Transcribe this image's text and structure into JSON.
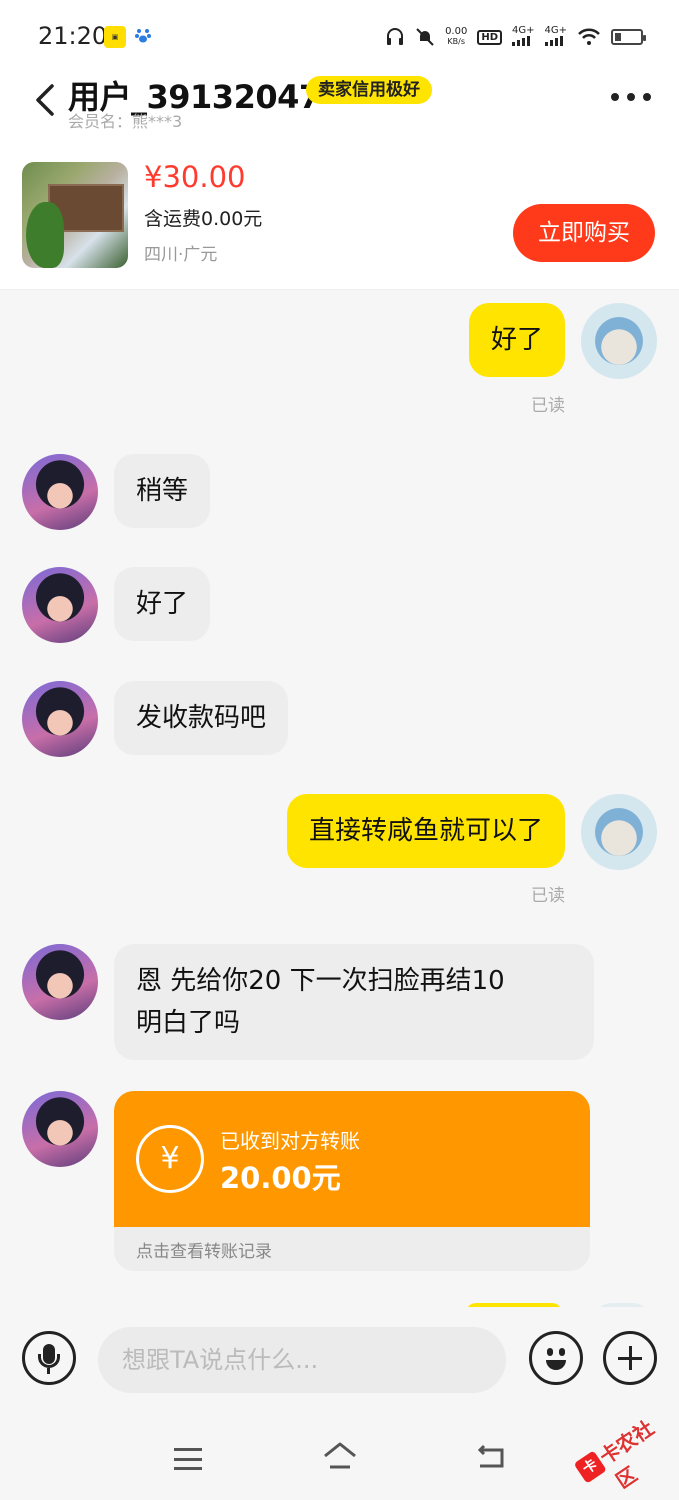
{
  "status_bar": {
    "time": "21:20",
    "net_speed": "0.00",
    "net_unit": "KB/s",
    "hd": "HD",
    "signal1": "4G+",
    "signal2": "4G+"
  },
  "header": {
    "title": "用户_39132047",
    "badge": "卖家信用极好",
    "subtitle": "会员名：熊***3"
  },
  "product": {
    "price": "¥30.00",
    "shipping": "含运费0.00元",
    "location": "四川·广元",
    "buy_label": "立即购买"
  },
  "messages": [
    {
      "side": "right",
      "text": "好了",
      "read": "已读"
    },
    {
      "side": "left",
      "text": "稍等"
    },
    {
      "side": "left",
      "text": "好了"
    },
    {
      "side": "left",
      "text": "发收款码吧"
    },
    {
      "side": "right",
      "text": "直接转咸鱼就可以了",
      "read": "已读"
    },
    {
      "side": "left",
      "text_line1": "恩  先给你20 下一次扫脸再结10",
      "text_line2": "明白了吗"
    }
  ],
  "transfer": {
    "label": "已收到对方转账",
    "amount": "20.00元",
    "link": "点击查看转账记录",
    "icon": "yuan-exchange-icon",
    "color": "#ff9800"
  },
  "input": {
    "placeholder": "想跟TA说点什么..."
  },
  "watermark": {
    "text": "卡农社区"
  },
  "colors": {
    "accent_yellow": "#ffe400",
    "buy_red": "#ff3a1a",
    "price_red": "#ff3b2f"
  }
}
